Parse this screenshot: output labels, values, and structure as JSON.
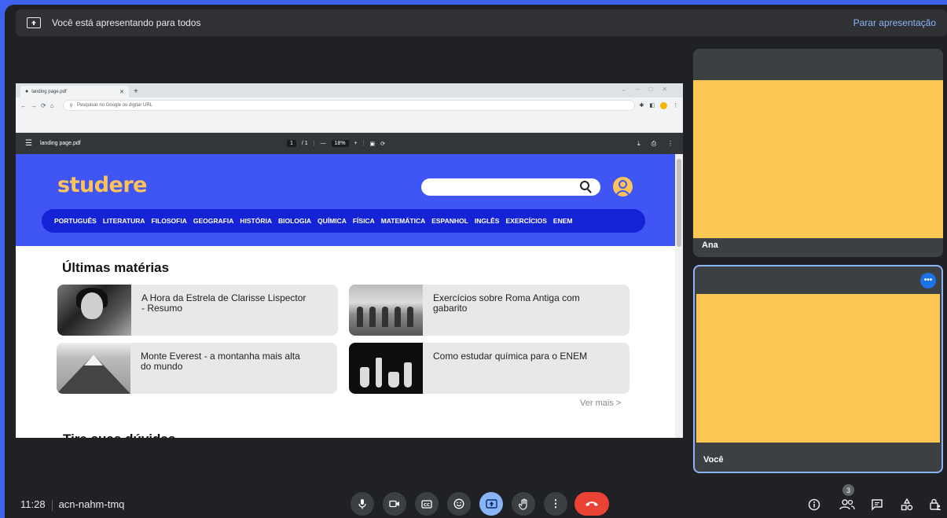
{
  "presenting_bar": {
    "message": "Você está apresentando para todos",
    "stop_label": "Parar apresentação"
  },
  "browser": {
    "tab_title": "landing page.pdf",
    "address_placeholder": "Pesquisar no Google ou digitar URL"
  },
  "pdf_viewer": {
    "file_name": "landing page.pdf",
    "current_page": "1",
    "total_pages": "/ 1",
    "zoom": "18%"
  },
  "site": {
    "logo": "studere",
    "nav": [
      "PORTUGUÊS",
      "LITERATURA",
      "FILOSOFIA",
      "GEOGRAFIA",
      "HISTÓRIA",
      "BIOLOGIA",
      "QUÍMICA",
      "FÍSICA",
      "MATEMÁTICA",
      "ESPANHOL",
      "INGLÊS",
      "EXERCÍCIOS",
      "ENEM"
    ],
    "latest_title": "Últimas matérias",
    "cards": [
      "A Hora da Estrela de Clarisse Lispector - Resumo",
      "Exercícios sobre Roma Antiga com gabarito",
      "Monte Everest - a montanha mais alta do mundo",
      "Como estudar química para o ENEM"
    ],
    "see_more": "Ver mais >",
    "doubts_title": "Tire suas dúvidas"
  },
  "participants": {
    "ana": "Ana",
    "you": "Você"
  },
  "meeting": {
    "time": "11:28",
    "code": "acn-nahm-tmq",
    "people_count": "3"
  },
  "colors": {
    "meet_bg": "#202124",
    "site_blue": "#4056f4",
    "nav_blue": "#1523d6",
    "logo_yellow": "#ffc35a",
    "tile_yellow": "#fec653",
    "hangup_red": "#ea4335",
    "present_blue": "#8ab4f8"
  }
}
